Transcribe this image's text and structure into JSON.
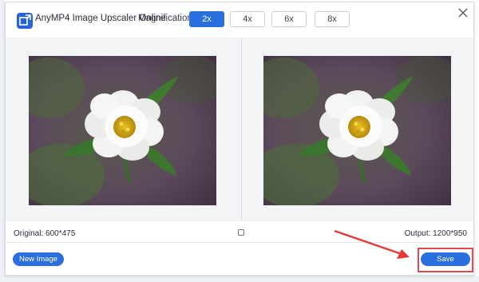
{
  "app": {
    "title": "AnyMP4 Image Upscaler Online",
    "logo_icon": "image-upscale-logo"
  },
  "magnification": {
    "label": "Magnification:",
    "options": [
      "2x",
      "4x",
      "6x",
      "8x"
    ],
    "selected": "2x"
  },
  "preview": {
    "original_label": "Original: 600*475",
    "output_label": "Output: 1200*950"
  },
  "actions": {
    "new_image": "New Image",
    "save": "Save"
  },
  "colors": {
    "accent": "#2a6fe0",
    "annotation": "#e24b4b"
  }
}
